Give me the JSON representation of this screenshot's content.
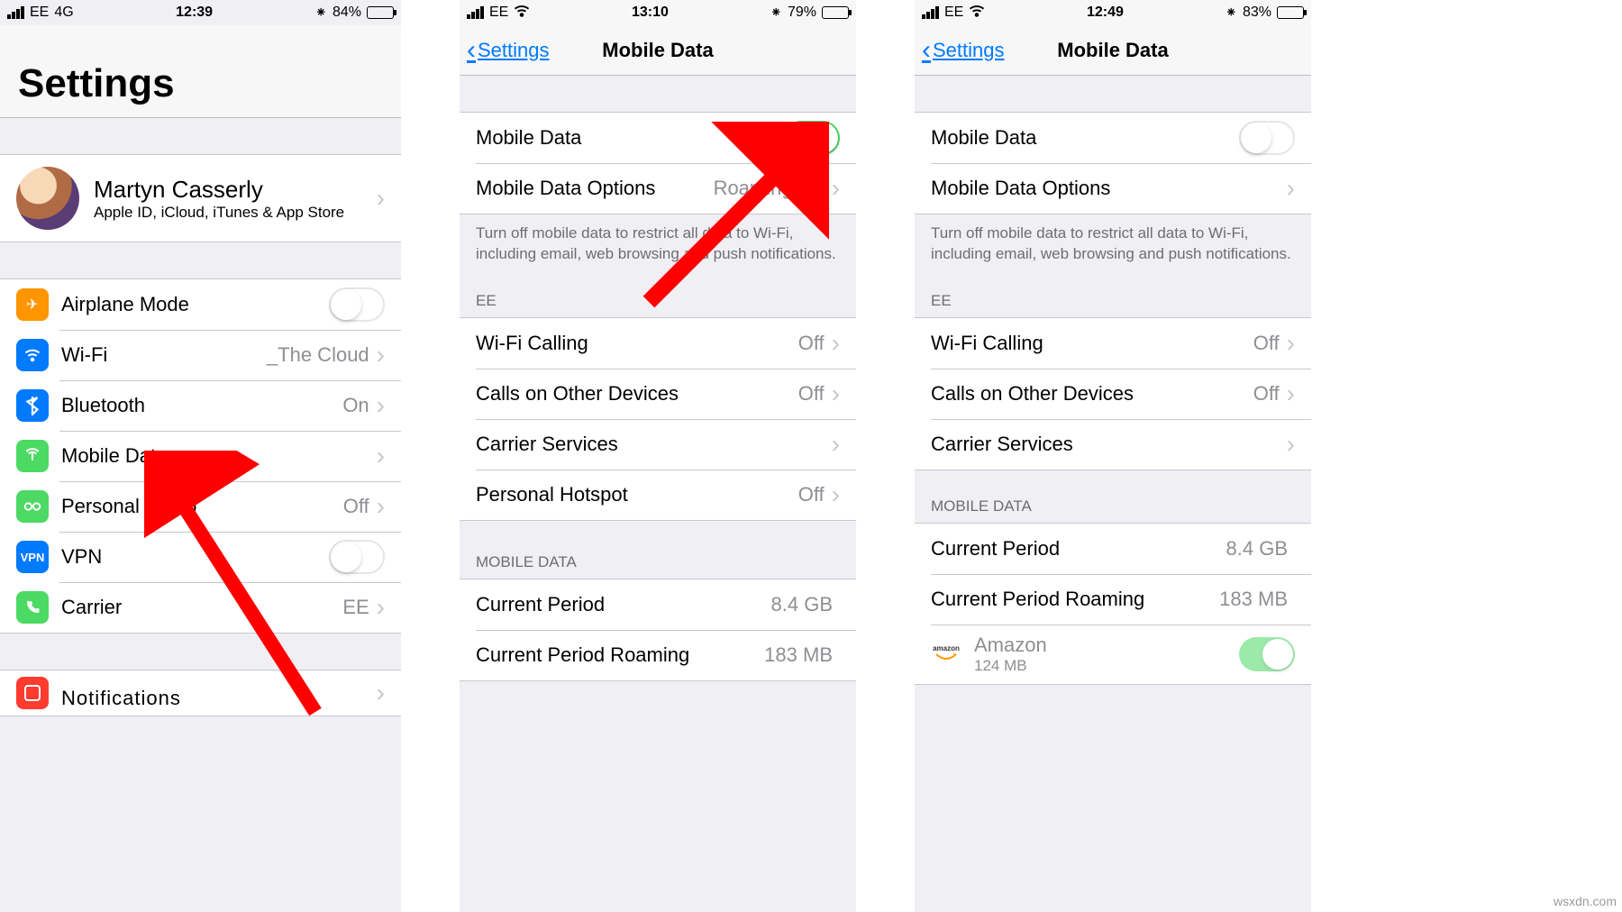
{
  "watermark": "wsxdn.com",
  "screens": {
    "s1": {
      "status": {
        "carrier": "EE",
        "net": "4G",
        "time": "12:39",
        "bt": "✱",
        "battery": "84%",
        "batteryFill": 84
      },
      "title": "Settings",
      "profile": {
        "name": "Martyn Casserly",
        "sub": "Apple ID, iCloud, iTunes & App Store"
      },
      "rows": {
        "airplane": {
          "label": "Airplane Mode"
        },
        "wifi": {
          "label": "Wi-Fi",
          "value": "_The Cloud"
        },
        "bluetooth": {
          "label": "Bluetooth",
          "value": "On"
        },
        "mobiledata": {
          "label": "Mobile Data"
        },
        "hotspot": {
          "label": "Personal Hotsp",
          "value": "Off"
        },
        "vpn": {
          "label": "VPN"
        },
        "carrier": {
          "label": "Carrier",
          "value": "EE"
        },
        "notifications": {
          "label": "Notifications"
        }
      }
    },
    "s2": {
      "status": {
        "carrier": "EE",
        "time": "13:10",
        "battery": "79%",
        "batteryFill": 79
      },
      "nav": {
        "back": "Settings",
        "title": "Mobile Data"
      },
      "rows": {
        "mobiledata": {
          "label": "Mobile Data"
        },
        "options": {
          "label": "Mobile Data Options",
          "value": "Roaming Off"
        }
      },
      "footer": "Turn off mobile data to restrict all data to Wi-Fi, including email, web browsing and push notifications.",
      "sectionCarrier": "EE",
      "rows2": {
        "wificall": {
          "label": "Wi-Fi Calling",
          "value": "Off"
        },
        "calls": {
          "label": "Calls on Other Devices",
          "value": "Off"
        },
        "services": {
          "label": "Carrier Services"
        },
        "hotspot": {
          "label": "Personal Hotspot",
          "value": "Off"
        }
      },
      "sectionData": "MOBILE DATA",
      "rows3": {
        "period": {
          "label": "Current Period",
          "value": "8.4 GB"
        },
        "roaming": {
          "label": "Current Period Roaming",
          "value": "183 MB"
        }
      }
    },
    "s3": {
      "status": {
        "carrier": "EE",
        "time": "12:49",
        "battery": "83%",
        "batteryFill": 83
      },
      "nav": {
        "back": "Settings",
        "title": "Mobile Data"
      },
      "rows": {
        "mobiledata": {
          "label": "Mobile Data"
        },
        "options": {
          "label": "Mobile Data Options"
        }
      },
      "footer": "Turn off mobile data to restrict all data to Wi-Fi, including email, web browsing and push notifications.",
      "sectionCarrier": "EE",
      "rows2": {
        "wificall": {
          "label": "Wi-Fi Calling",
          "value": "Off"
        },
        "calls": {
          "label": "Calls on Other Devices",
          "value": "Off"
        },
        "services": {
          "label": "Carrier Services"
        }
      },
      "sectionData": "MOBILE DATA",
      "rows3": {
        "period": {
          "label": "Current Period",
          "value": "8.4 GB"
        },
        "roaming": {
          "label": "Current Period Roaming",
          "value": "183 MB"
        }
      },
      "app": {
        "name": "Amazon",
        "sub": "124 MB",
        "brand": "amazon"
      }
    }
  }
}
